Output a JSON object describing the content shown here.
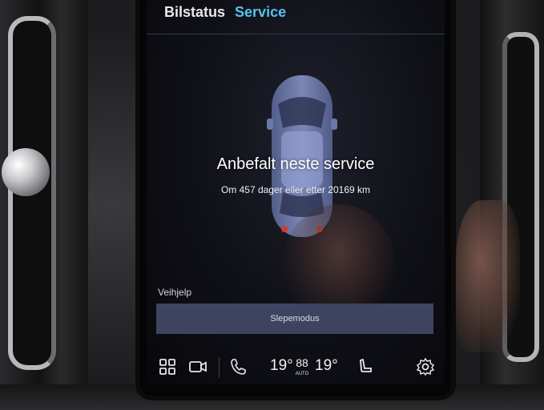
{
  "header": {
    "tabs": [
      {
        "label": "Bilstatus",
        "active": false
      },
      {
        "label": "Service",
        "active": true
      }
    ]
  },
  "service": {
    "title": "Anbefalt neste service",
    "detail": "Om 457 dager eller etter 20169 km"
  },
  "assistance": {
    "section_label": "Veihjelp",
    "tow_mode_label": "Slepemodus"
  },
  "climate_bar": {
    "left_temp": "19°",
    "fan_value": "88",
    "fan_mode": "AUTO",
    "right_temp": "19°",
    "icons": [
      "apps-grid-icon",
      "camera-icon",
      "phone-icon",
      "seat-heat-icon",
      "settings-gear-icon"
    ]
  },
  "colors": {
    "active_tab": "#56c2f0",
    "button_bg": "#3e4460",
    "screen_bg": "#0f1016"
  }
}
